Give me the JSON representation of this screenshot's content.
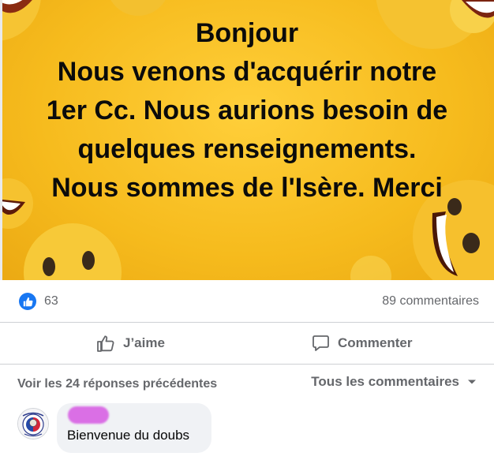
{
  "post": {
    "banner_lines": [
      "Bonjour",
      "Nous venons d'acquérir notre",
      "1er Cc. Nous aurions besoin de",
      "quelques renseignements.",
      "Nous sommes de l'Isère. Merci"
    ],
    "banner_background": "#f6bb1d"
  },
  "stats": {
    "reaction_icon": "like-icon",
    "reactions_count": "63",
    "comments_count": "89 commentaires"
  },
  "actions": {
    "like_label": "J’aime",
    "comment_label": "Commenter"
  },
  "comments_section": {
    "previous_replies_label": "Voir les 24 réponses précédentes",
    "sort_label": "Tous les commentaires",
    "comments": [
      {
        "author_redacted": true,
        "text": "Bienvenue du doubs"
      }
    ]
  },
  "colors": {
    "accent": "#1877f2",
    "muted_text": "#65676b",
    "bubble": "#f0f2f5",
    "redaction": "#da6fe5"
  }
}
